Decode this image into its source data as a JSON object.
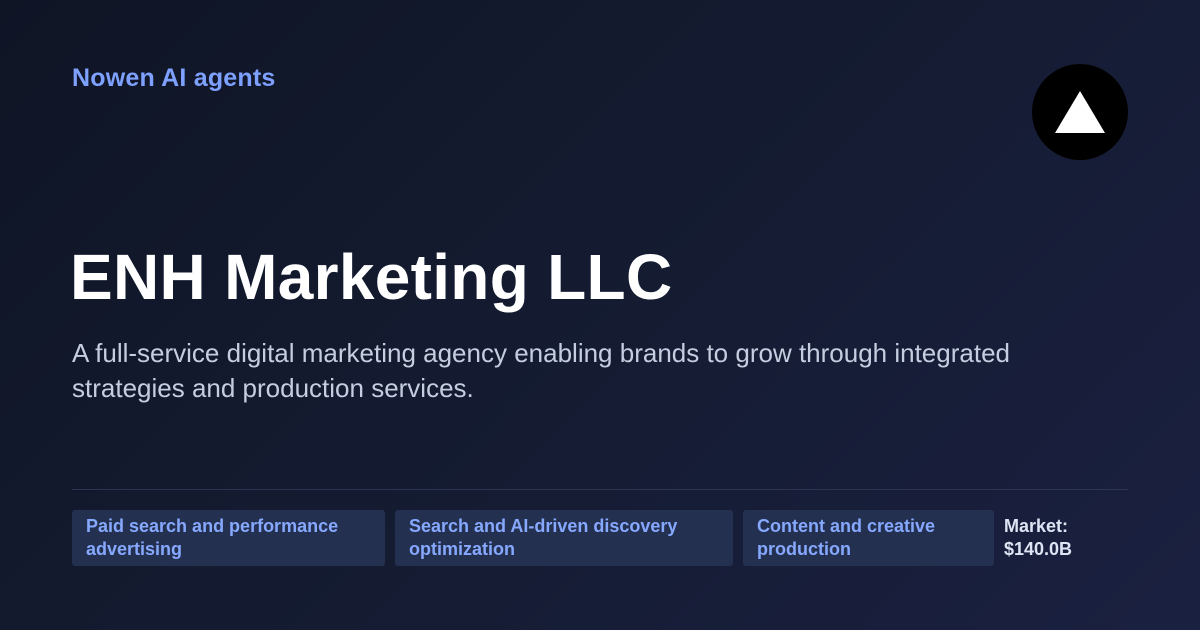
{
  "header": {
    "brand": "Nowen AI agents"
  },
  "logo": {
    "icon": "triangle-logo-icon"
  },
  "company": {
    "name": "ENH Marketing LLC",
    "description": "A full-service digital marketing agency enabling brands to grow through integrated strategies and production services."
  },
  "tags": [
    {
      "label": "Paid search and performance advertising"
    },
    {
      "label": "Search and AI-driven discovery optimization"
    },
    {
      "label": "Content and creative production"
    }
  ],
  "market": {
    "label": "Market:",
    "value": "$140.0B"
  },
  "colors": {
    "accent": "#7ea1ff",
    "background": "#141b30",
    "tag_background": "#233050"
  }
}
